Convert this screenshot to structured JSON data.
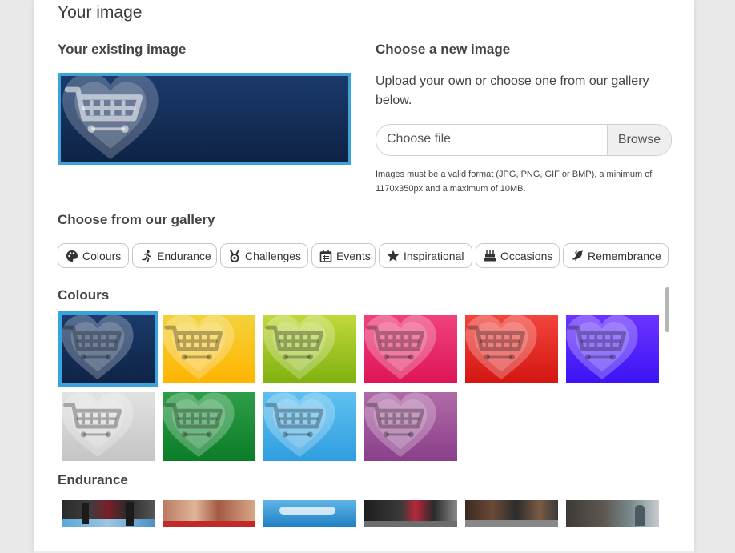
{
  "section_title": "Your image",
  "existing": {
    "heading": "Your existing image",
    "image": "heart-basket-navy"
  },
  "new_image": {
    "heading": "Choose a new image",
    "description": "Upload your own or choose one from our gallery below.",
    "file_placeholder": "Choose file",
    "browse_label": "Browse",
    "note": "Images must be a valid format (JPG, PNG, GIF or BMP), a minimum of 1170x350px and a maximum of 10MB."
  },
  "gallery": {
    "heading": "Choose from our gallery",
    "tabs": [
      {
        "label": "Colours",
        "icon": "palette-icon"
      },
      {
        "label": "Endurance",
        "icon": "runner-icon"
      },
      {
        "label": "Challenges",
        "icon": "medal-icon"
      },
      {
        "label": "Events",
        "icon": "calendar-icon"
      },
      {
        "label": "Inspirational",
        "icon": "star-icon"
      },
      {
        "label": "Occasions",
        "icon": "cake-icon"
      },
      {
        "label": "Remembrance",
        "icon": "dove-icon"
      }
    ],
    "categories": [
      {
        "title": "Colours",
        "items": [
          {
            "name": "navy",
            "top": "#1b3a6b",
            "bottom": "#0e2346",
            "selected": true
          },
          {
            "name": "yellow",
            "top": "#f3d23a",
            "bottom": "#ffb400",
            "selected": false
          },
          {
            "name": "lime",
            "top": "#c2d93c",
            "bottom": "#7fb10f",
            "selected": false
          },
          {
            "name": "pink",
            "top": "#f0427f",
            "bottom": "#dd1556",
            "selected": false
          },
          {
            "name": "red",
            "top": "#f2453d",
            "bottom": "#d41511",
            "selected": false
          },
          {
            "name": "violet",
            "top": "#6c34ff",
            "bottom": "#3b13f5",
            "selected": false
          },
          {
            "name": "grey",
            "top": "#e2e2e2",
            "bottom": "#c4c4c4",
            "selected": false
          },
          {
            "name": "green",
            "top": "#2e9e48",
            "bottom": "#0b7c27",
            "selected": false
          },
          {
            "name": "sky",
            "top": "#5fc0f0",
            "bottom": "#2f9ee0",
            "selected": false
          },
          {
            "name": "purple",
            "top": "#b06aa8",
            "bottom": "#8a3f8a",
            "selected": false
          }
        ]
      },
      {
        "title": "Endurance",
        "items": [
          {
            "name": "cyclists-legs"
          },
          {
            "name": "runners-start"
          },
          {
            "name": "swimmer"
          },
          {
            "name": "cyclist-red"
          },
          {
            "name": "runners-road"
          },
          {
            "name": "hikers"
          }
        ]
      }
    ]
  }
}
